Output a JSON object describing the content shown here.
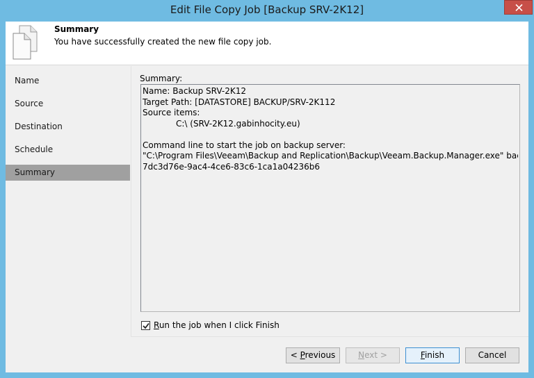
{
  "window": {
    "title": "Edit File Copy Job [Backup SRV-2K12]"
  },
  "header": {
    "title": "Summary",
    "subtitle": "You have successfully created the new file copy job."
  },
  "nav": {
    "items": [
      {
        "label": "Name"
      },
      {
        "label": "Source"
      },
      {
        "label": "Destination"
      },
      {
        "label": "Schedule"
      },
      {
        "label": "Summary",
        "active": true
      }
    ]
  },
  "summary": {
    "label": "Summary:",
    "lines": {
      "name": "Name: Backup SRV-2K12",
      "target_path": "Target Path: [DATASTORE] BACKUP/SRV-2K112",
      "source_items_label": "Source items:",
      "source_item": "C:\\ (SRV-2K12.gabinhocity.eu)",
      "cmd_label": "Command line to start the job on backup server:",
      "cmd_line": "\"C:\\Program Files\\Veeam\\Backup and Replication\\Backup\\Veeam.Backup.Manager.exe\" backup",
      "cmd_id": "7dc3d76e-9ac4-4ce6-83c6-1ca1a04236b6"
    }
  },
  "run_checkbox": {
    "label": "Run the job when I click Finish",
    "checked": true
  },
  "buttons": {
    "previous_prefix": "< ",
    "previous_underlined": "P",
    "previous_rest": "revious",
    "next_underlined": "N",
    "next_rest": "ext >",
    "finish_underlined": "F",
    "finish_rest": "inish",
    "cancel": "Cancel"
  },
  "colors": {
    "titlebar": "#6fbbe2",
    "close_button": "#c74f48",
    "active_nav": "#a0a0a0"
  }
}
